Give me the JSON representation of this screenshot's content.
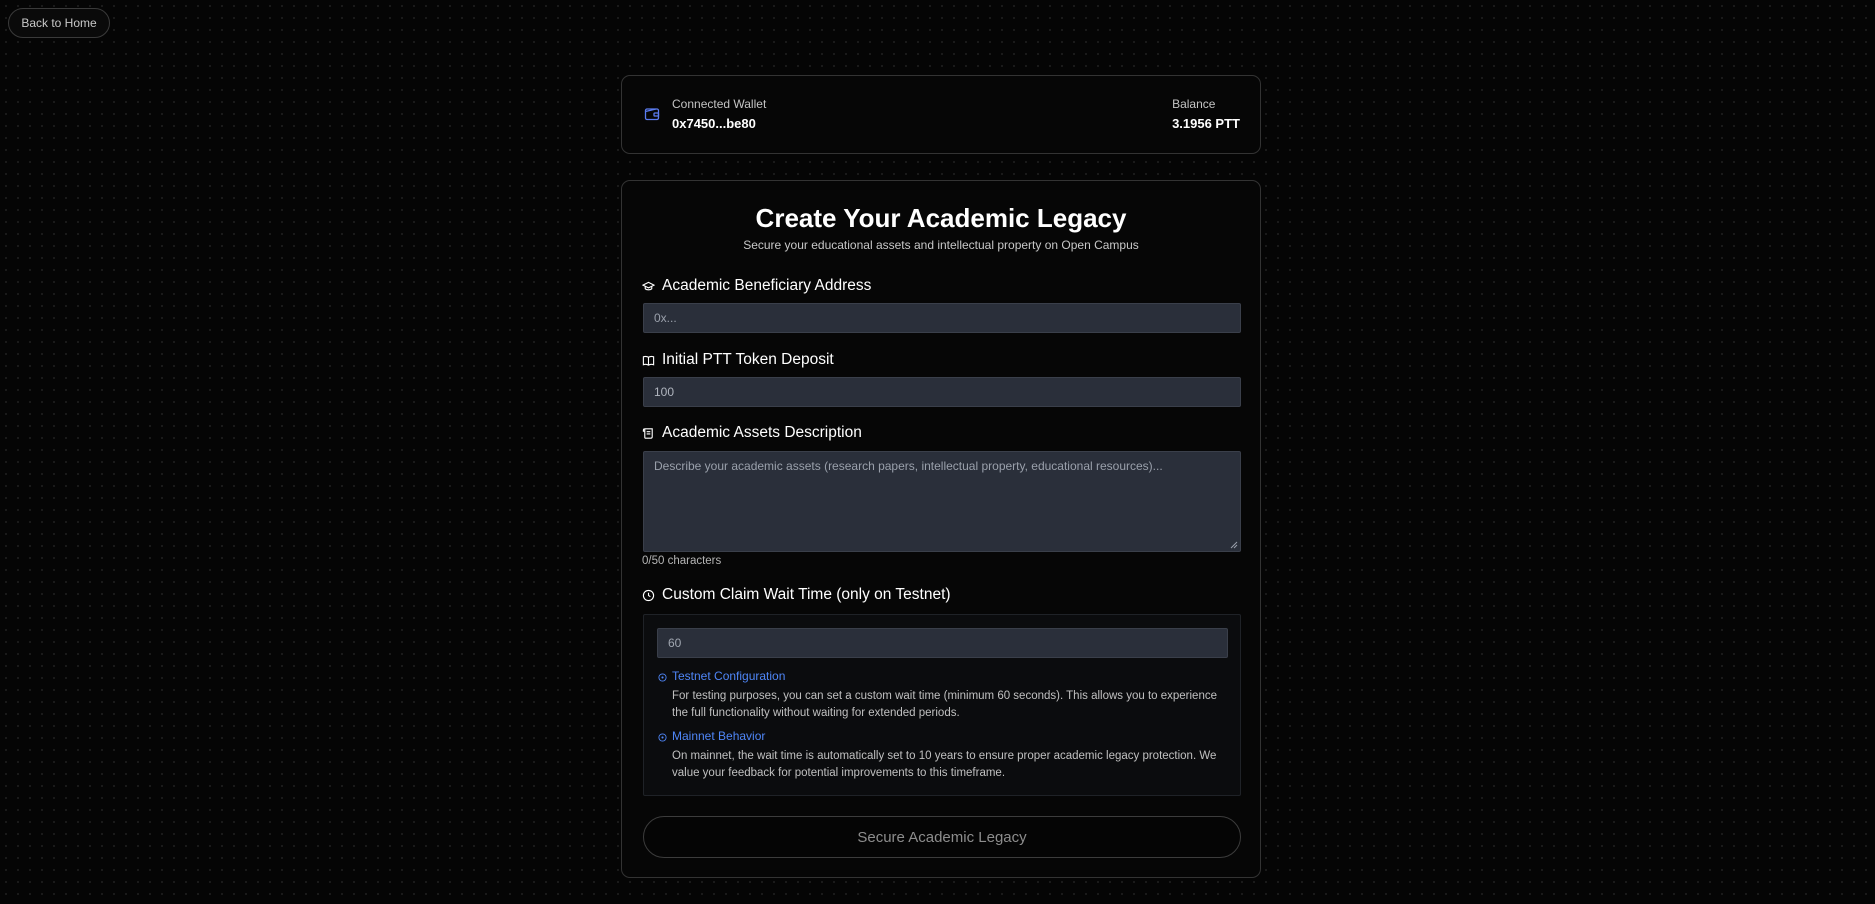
{
  "nav": {
    "back_label": "Back to Home"
  },
  "wallet": {
    "connected_label": "Connected Wallet",
    "address": "0x7450...be80",
    "balance_label": "Balance",
    "balance_value": "3.1956 PTT"
  },
  "form": {
    "title": "Create Your Academic Legacy",
    "subtitle": "Secure your educational assets and intellectual property on Open Campus",
    "beneficiary": {
      "label": "Academic Beneficiary Address",
      "placeholder": "0x...",
      "icon": "graduation-cap-icon"
    },
    "deposit": {
      "label": "Initial PTT Token Deposit",
      "value": "100",
      "icon": "book-open-icon"
    },
    "description": {
      "label": "Academic Assets Description",
      "placeholder": "Describe your academic assets (research papers, intellectual property, educational resources)...",
      "char_count": "0/50 characters",
      "icon": "scroll-icon"
    },
    "wait_time": {
      "label": "Custom Claim Wait Time (only on Testnet)",
      "value": "60",
      "icon": "clock-icon",
      "testnet_title": "Testnet Configuration",
      "testnet_text": "For testing purposes, you can set a custom wait time (minimum 60 seconds). This allows you to experience the full functionality without waiting for extended periods.",
      "mainnet_title": "Mainnet Behavior",
      "mainnet_text": "On mainnet, the wait time is automatically set to 10 years to ensure proper academic legacy protection. We value your feedback for potential improvements to this timeframe."
    },
    "submit_label": "Secure Academic Legacy"
  },
  "colors": {
    "accent": "#4f86f7",
    "input_bg": "#2a2f3a",
    "page_bg": "#050505"
  }
}
